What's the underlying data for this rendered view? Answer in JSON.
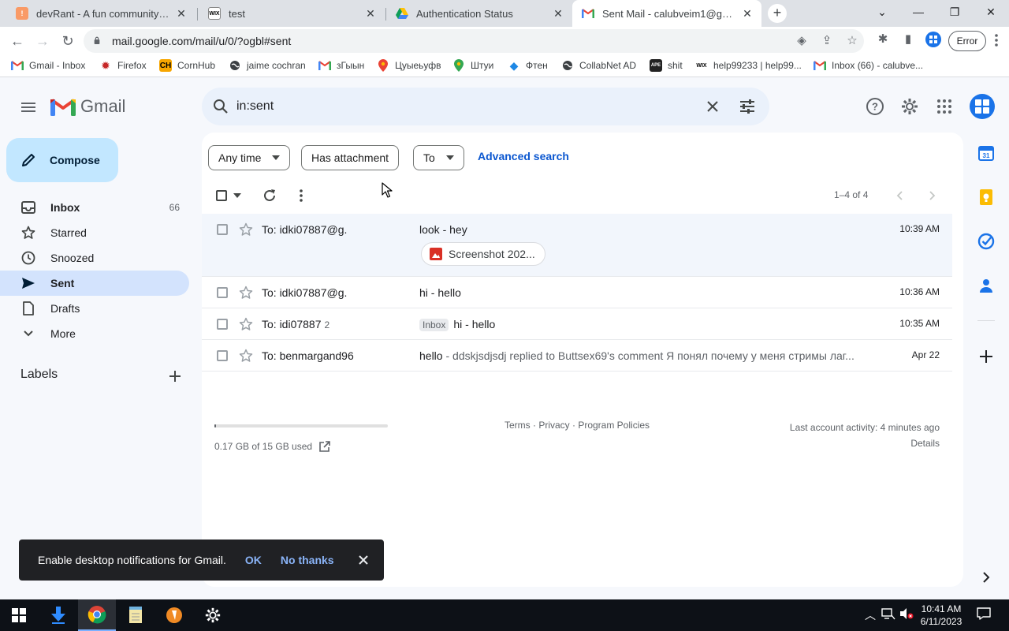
{
  "browser": {
    "tabs": [
      {
        "title": "devRant - A fun community for d",
        "icon": "devrant-icon"
      },
      {
        "title": "test",
        "icon": "wix-icon"
      },
      {
        "title": "Authentication Status",
        "icon": "google-drive-icon"
      },
      {
        "title": "Sent Mail - calubveim1@gmail.com",
        "icon": "gmail-icon",
        "active": true
      }
    ],
    "new_tab": "+",
    "url": "mail.google.com/mail/u/0/?ogbl#sent",
    "profile_status": "Error",
    "bookmarks": [
      {
        "label": "Gmail - Inbox",
        "icon": "gmail-icon"
      },
      {
        "label": "Firefox",
        "icon": "firefox-icon"
      },
      {
        "label": "CornHub",
        "icon": "ch-icon",
        "icon_text": "CH"
      },
      {
        "label": "jaime cochran",
        "icon": "globe-icon"
      },
      {
        "label": "зГыын",
        "icon": "gmail-icon"
      },
      {
        "label": "Цуыеьуфв",
        "icon": "maps-icon"
      },
      {
        "label": "Штуи",
        "icon": "maps-icon"
      },
      {
        "label": "Фтен",
        "icon": "diamond-icon"
      },
      {
        "label": "CollabNet AD",
        "icon": "globe-icon"
      },
      {
        "label": "shit",
        "icon": "ape-icon",
        "icon_text": "APE"
      },
      {
        "label": "help99233 | help99...",
        "icon": "wix-icon",
        "icon_text": "WIX"
      },
      {
        "label": "Inbox (66) - calubve...",
        "icon": "gmail-icon"
      }
    ]
  },
  "gmail": {
    "wordmark": "Gmail",
    "search": {
      "value": "in:sent"
    },
    "compose_label": "Compose",
    "nav": [
      {
        "label": "Inbox",
        "count": "66",
        "icon": "inbox-icon",
        "bold": true
      },
      {
        "label": "Starred",
        "count": "",
        "icon": "star-icon"
      },
      {
        "label": "Snoozed",
        "count": "",
        "icon": "clock-icon"
      },
      {
        "label": "Sent",
        "count": "",
        "icon": "send-icon",
        "active": true
      },
      {
        "label": "Drafts",
        "count": "",
        "icon": "draft-icon"
      },
      {
        "label": "More",
        "count": "",
        "icon": "chevron-down-icon"
      }
    ],
    "labels_header": "Labels",
    "filters": {
      "any_time": "Any time",
      "has_attachment": "Has attachment",
      "to": "To",
      "advanced": "Advanced search"
    },
    "page_info": "1–4 of 4",
    "emails": [
      {
        "to": "To: idki07887@g.",
        "count": "",
        "badge": "",
        "subject": "look - hey",
        "snippet": "",
        "date": "10:39 AM",
        "attachment": "Screenshot 202..."
      },
      {
        "to": "To: idki07887@g.",
        "count": "",
        "badge": "",
        "subject": "hi - hello",
        "snippet": "",
        "date": "10:36 AM",
        "attachment": ""
      },
      {
        "to": "To: idi07887",
        "count": "2",
        "badge": "Inbox",
        "subject": "hi - hello",
        "snippet": "",
        "date": "10:35 AM",
        "attachment": ""
      },
      {
        "to": "To: benmargand96",
        "count": "",
        "badge": "",
        "subject": "hello",
        "snippet": " - ddskjsdjsdj replied to Buttsex69's comment Я понял почему у меня стримы лаг...",
        "date": "Apr 22",
        "attachment": ""
      }
    ],
    "storage": {
      "text": "0.17 GB of 15 GB used",
      "used_fraction": 0.011
    },
    "footer_links": "Terms · Privacy · Program Policies",
    "activity": {
      "line1": "Last account activity: 4 minutes ago",
      "line2": "Details"
    },
    "snackbar": {
      "message": "Enable desktop notifications for Gmail.",
      "ok": "OK",
      "no_thanks": "No thanks"
    }
  },
  "taskbar": {
    "time": "10:41 AM",
    "date": "6/11/2023"
  },
  "colors": {
    "accent": "#0b57d0",
    "compose_bg": "#c2e7ff",
    "nav_active_bg": "#d3e3fd",
    "search_bg": "#eaf1fb"
  }
}
